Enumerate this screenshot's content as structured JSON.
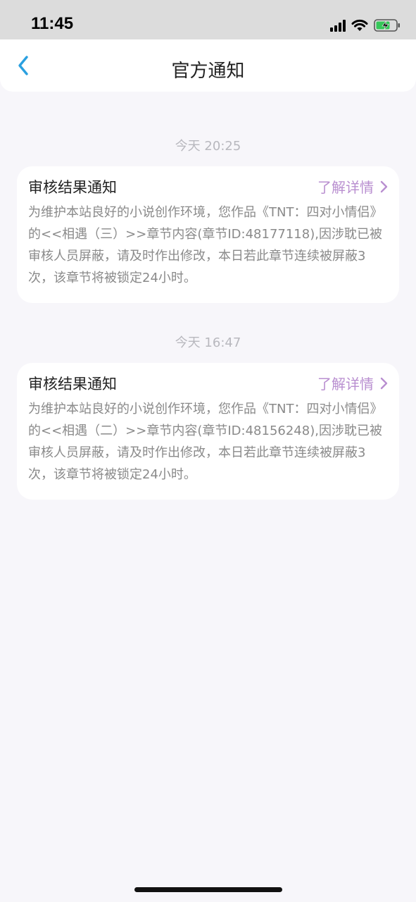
{
  "status_bar": {
    "time": "11:45"
  },
  "nav": {
    "title": "官方通知",
    "back_icon": "chevron-left-icon"
  },
  "notifications": [
    {
      "time": "今天 20:25",
      "title": "审核结果通知",
      "link_label": "了解详情",
      "body": "为维护本站良好的小说创作环境，您作品《TNT：四对小情侣》的<<相遇（三）>>章节内容(章节ID:48177118),因涉耽已被审核人员屏蔽，请及时作出修改，本日若此章节连续被屏蔽3次，该章节将被锁定24小时。"
    },
    {
      "time": "今天 16:47",
      "title": "审核结果通知",
      "link_label": "了解详情",
      "body": "为维护本站良好的小说创作环境，您作品《TNT：四对小情侣》的<<相遇（二）>>章节内容(章节ID:48156248),因涉耽已被审核人员屏蔽，请及时作出修改，本日若此章节连续被屏蔽3次，该章节将被锁定24小时。"
    }
  ],
  "colors": {
    "accent_link": "#b98fd0",
    "back_icon": "#2aa0e0",
    "background": "#f7f6fa"
  }
}
